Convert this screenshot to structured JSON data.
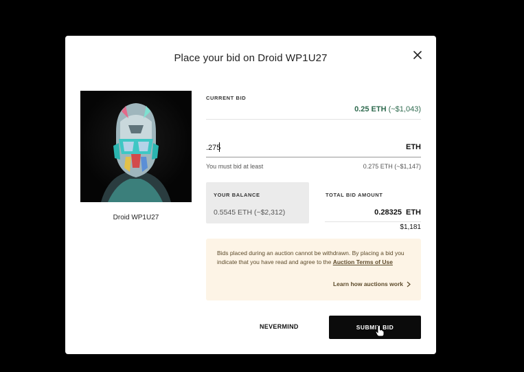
{
  "modal": {
    "title": "Place your bid on Droid WP1U27",
    "close_icon": "close-icon"
  },
  "artwork": {
    "caption": "Droid WP1U27"
  },
  "current_bid": {
    "label": "CURRENT BID",
    "eth": "0.25 ETH",
    "usd": "(~$1,043)"
  },
  "bid_input": {
    "value": ".275",
    "unit": "ETH",
    "min_note": "You must bid at least",
    "min_value": "0.275 ETH (~$1,147)"
  },
  "balance": {
    "label": "YOUR BALANCE",
    "value": "0.5545 ETH (~$2,312)"
  },
  "total": {
    "label": "TOTAL BID AMOUNT",
    "eth": "0.28325",
    "unit": "ETH",
    "usd": "$1,181"
  },
  "notice": {
    "text": "Bids placed during an auction cannot be withdrawn. By placing a bid you indicate that you have read and agree to the ",
    "terms_link": "Auction Terms of Use",
    "learn_link": "Learn how auctions work"
  },
  "actions": {
    "cancel_label": "NEVERMIND",
    "submit_label": "SUBMIT BID"
  },
  "colors": {
    "accent_green": "#2e6a4e",
    "notice_bg": "#fdf4e6",
    "submit_bg": "#0b0b0b"
  }
}
